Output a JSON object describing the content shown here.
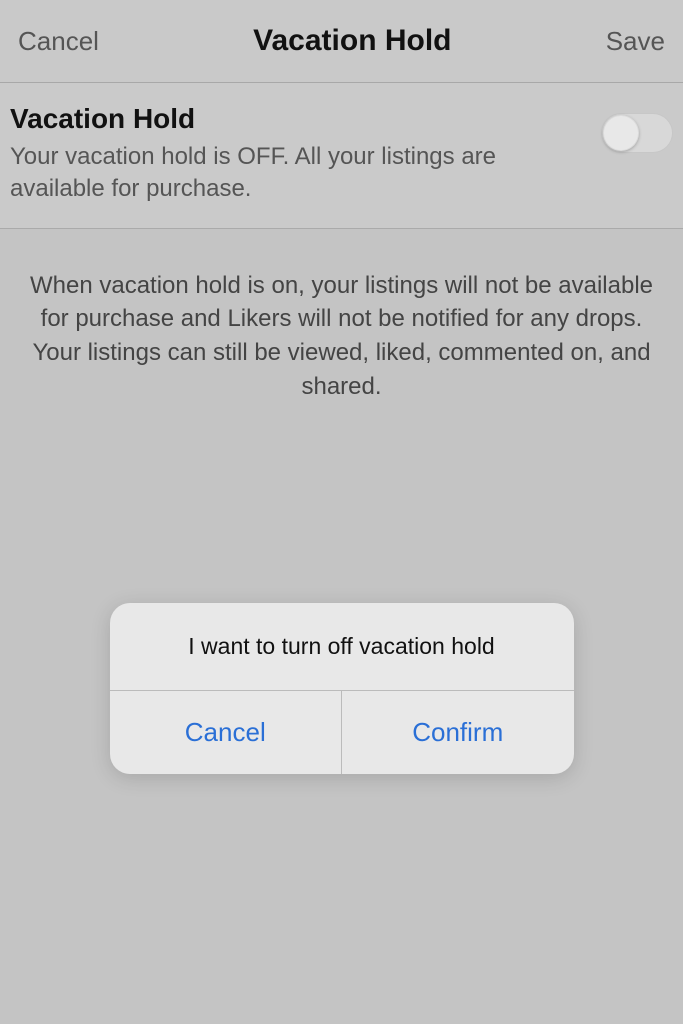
{
  "header": {
    "cancel": "Cancel",
    "title": "Vacation Hold",
    "save": "Save"
  },
  "section": {
    "title": "Vacation Hold",
    "desc": "Your vacation hold is OFF. All your listings are available for purchase."
  },
  "info": {
    "text": "When vacation hold is on, your listings will not be available for purchase and Likers will not be notified for any drops. Your listings can still be viewed, liked, commented on, and shared."
  },
  "dialog": {
    "title": "I want to turn off vacation hold",
    "cancel": "Cancel",
    "confirm": "Confirm"
  }
}
